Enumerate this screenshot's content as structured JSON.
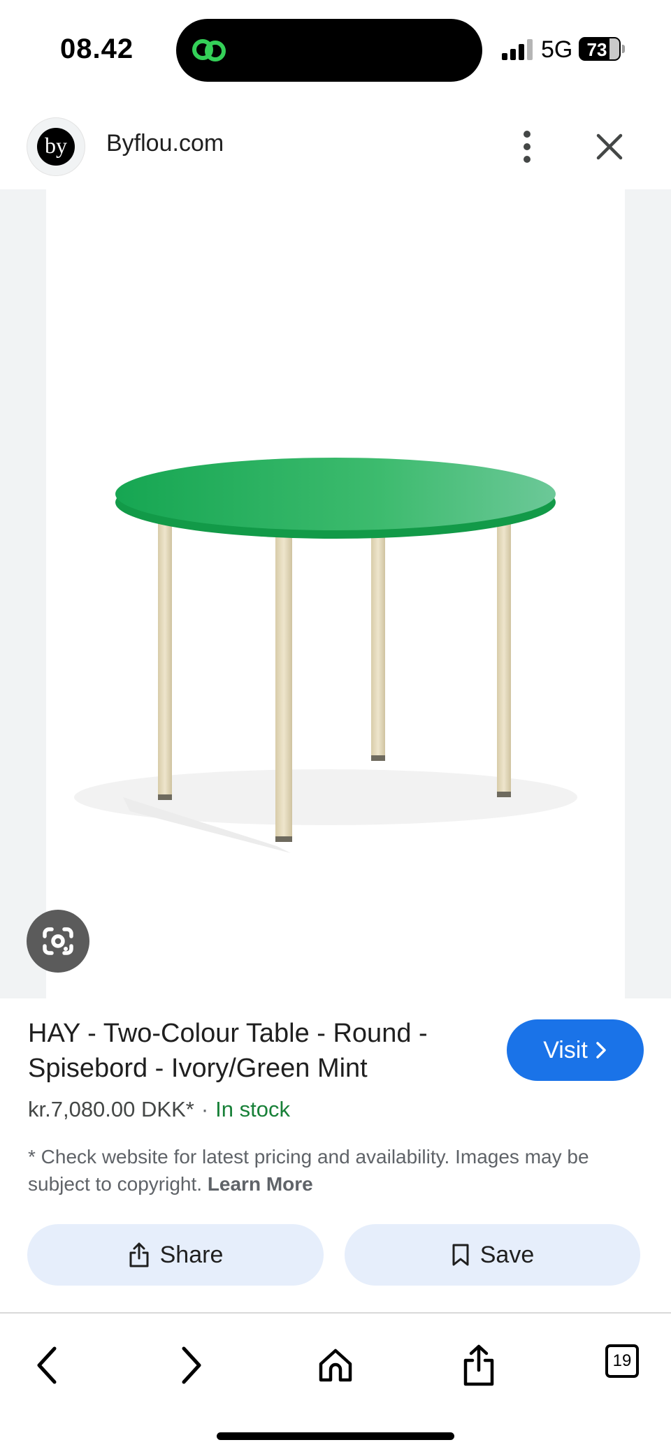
{
  "status_bar": {
    "time": "08.42",
    "network": "5G",
    "battery": "73",
    "dynamic_island_icon": "link-icon"
  },
  "header": {
    "logo_text": "by",
    "site_name": "Byflou.com",
    "more_icon": "more-vert-icon",
    "close_icon": "close-icon"
  },
  "image": {
    "lens_icon": "google-lens-icon",
    "colors": {
      "tabletop": "#1aa85a",
      "tabletop_top": "#2fb864",
      "legs": "#e6dcc0"
    }
  },
  "product": {
    "title": "HAY - Two-Colour Table - Round - Spisebord - Ivory/Green Mint",
    "price": "kr.7,080.00 DKK*",
    "separator": "·",
    "stock": "In stock",
    "disclaimer": "* Check website for latest pricing and availability. Images may be subject to copyright.",
    "learn_more": "Learn More",
    "visit_label": "Visit"
  },
  "actions": {
    "share_label": "Share",
    "save_label": "Save"
  },
  "toolbar": {
    "tabs_count": "19"
  },
  "colors": {
    "accent": "#1a73e8",
    "in_stock": "#188038",
    "pill_bg": "#e6eefb"
  }
}
